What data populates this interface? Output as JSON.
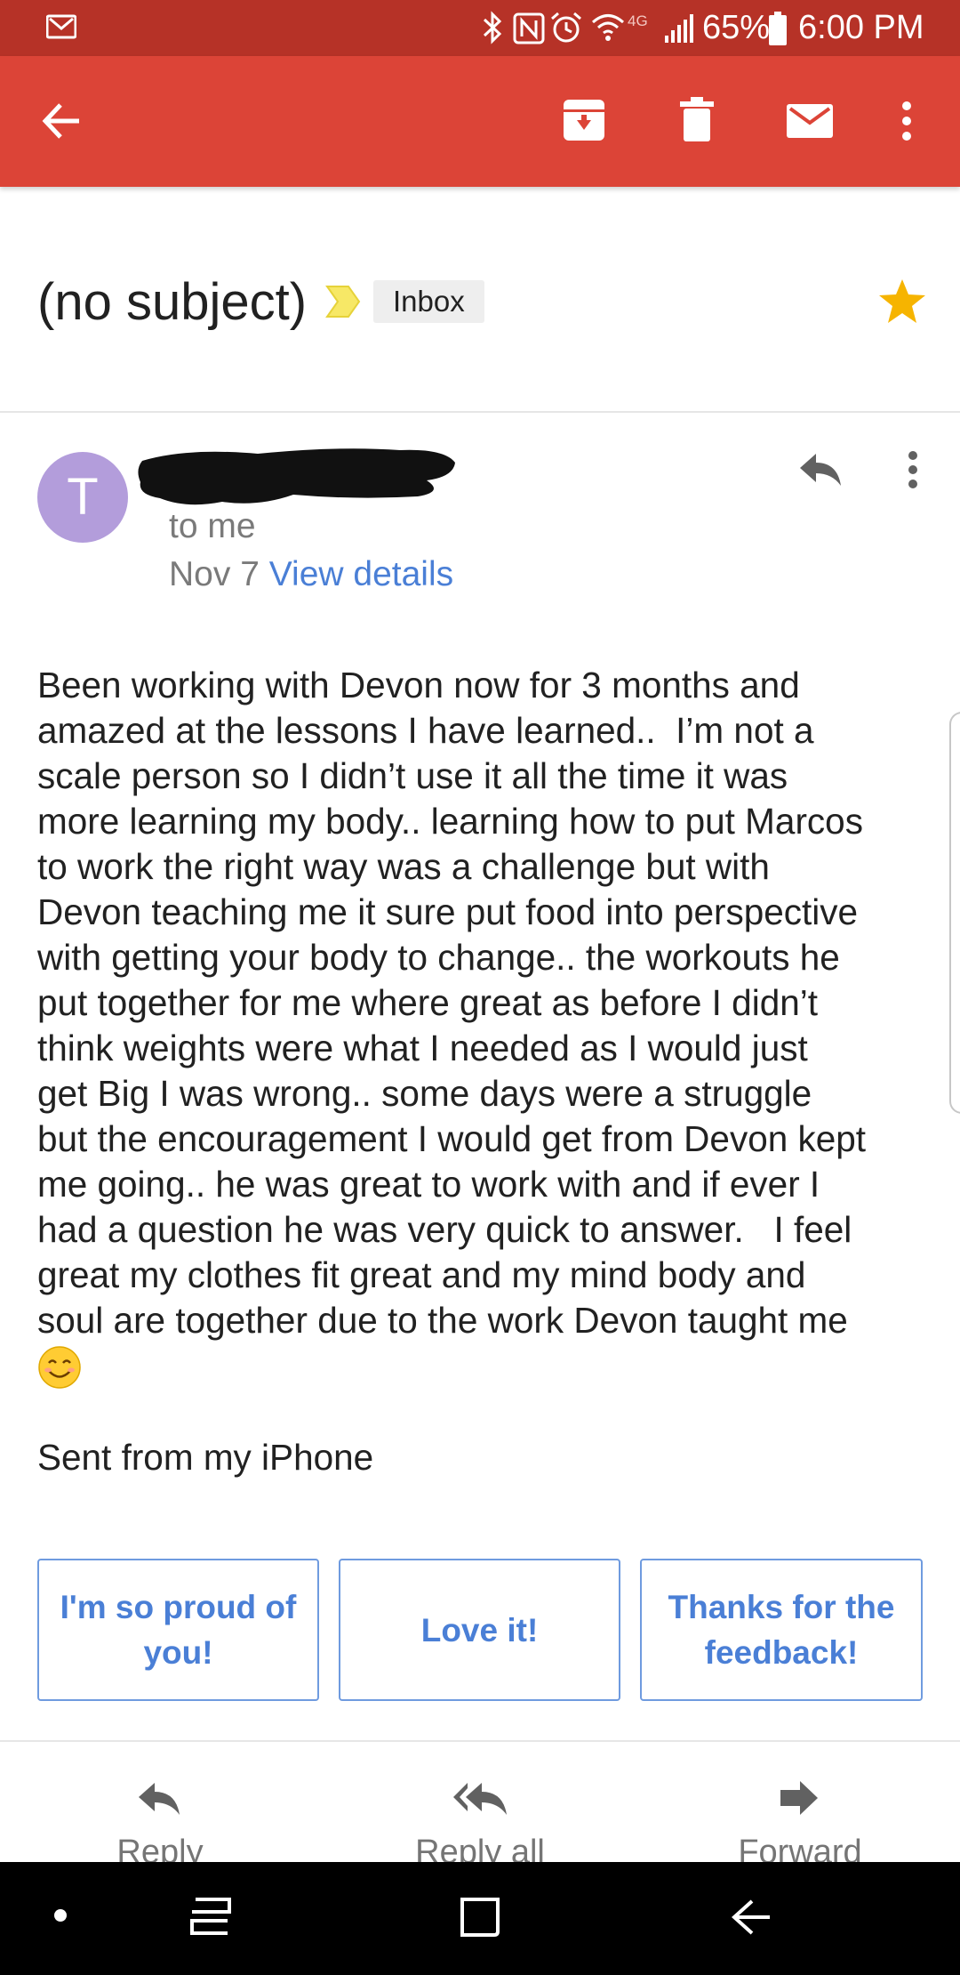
{
  "status_bar": {
    "battery": "65%",
    "time": "6:00 PM",
    "network": "4G",
    "icons": [
      "gmail-notification-icon",
      "bluetooth-icon",
      "nfc-icon",
      "alarm-icon",
      "wifi-icon",
      "signal-icon",
      "battery-icon"
    ]
  },
  "toolbar": {
    "icons": [
      "back-arrow-icon",
      "archive-icon",
      "delete-icon",
      "mark-unread-icon",
      "more-vert-icon"
    ]
  },
  "email": {
    "subject": "(no subject)",
    "label": "Inbox",
    "starred": true,
    "sender_initial": "T",
    "recipient": "to me",
    "date": "Nov 7",
    "view_details": "View details",
    "body": "Been working with Devon now for 3 months and\namazed at the lessons I have learned..  I’m not a\nscale person so I didn’t use it all the time it was\nmore learning my body.. learning how to put Marcos\nto work the right way was a challenge but with\nDevon teaching me it sure put food into perspective\nwith getting your body to change.. the workouts he\nput together for me where great as before I didn’t\nthink weights were what I needed as I would just\nget Big I was wrong.. some days were a struggle\nbut the encouragement I would get from Devon kept\nme going.. he was great to work with and if ever I\nhad a question he was very quick to answer.   I feel\ngreat my clothes fit great and my mind body and\nsoul are together due to the work Devon taught me",
    "emoji": "smiling-face-emoji",
    "signature": "Sent from my iPhone"
  },
  "smart_replies": [
    "I'm so proud of you!",
    "Love it!",
    "Thanks for the feedback!"
  ],
  "actions": {
    "reply": "Reply",
    "reply_all": "Reply all",
    "forward": "Forward"
  },
  "colors": {
    "status_bar": "#b63227",
    "app_bar": "#dc4437",
    "link": "#4a7fd6",
    "avatar": "#b39ddb",
    "star": "#f6b400",
    "importance_marker": "#f7e866"
  }
}
